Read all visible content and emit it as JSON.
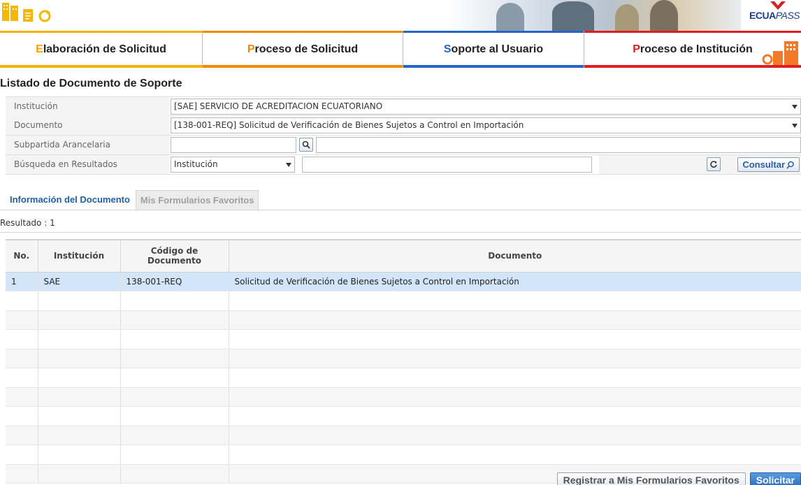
{
  "header": {
    "brand_main": "ECUA",
    "brand_suffix": "PASS",
    "icons": [
      "document-stack-icon",
      "form-icon",
      "refresh-icon"
    ]
  },
  "nav": [
    {
      "first": "E",
      "rest": "laboración de Solicitud"
    },
    {
      "first": "P",
      "rest": "roceso de Solicitud"
    },
    {
      "first": "S",
      "rest": "oporte al Usuario"
    },
    {
      "first": "P",
      "rest": "roceso de Institución"
    }
  ],
  "page_title": "Listado de Documento de Soporte",
  "form": {
    "institucion_label": "Institución",
    "institucion_value": "[SAE] SERVICIO DE ACREDITACION ECUATORIANO",
    "documento_label": "Documento",
    "documento_value": "[138-001-REQ] Solicitud de Verificación de Bienes Sujetos a Control en Importación",
    "subpartida_label": "Subpartida Arancelaria",
    "subpartida_value": "",
    "subpartida_desc": "",
    "busqueda_label": "Búsqueda en Resultados",
    "busqueda_field": "Institución",
    "busqueda_text": "",
    "consultar_label": "Consultar"
  },
  "tabs": {
    "active": "Información del Documento",
    "inactive": "Mis Formularios Favoritos"
  },
  "result_count": "Resultado : 1",
  "table": {
    "headers": [
      "No.",
      "Institución",
      "Código de Documento",
      "Documento"
    ],
    "rows": [
      {
        "no": "1",
        "institucion": "SAE",
        "codigo": "138-001-REQ",
        "documento": "Solicitud de Verificación de Bienes Sujetos a Control en Importación"
      }
    ],
    "empty_rows": 10
  },
  "buttons": {
    "favoritos": "Registrar a Mis Formularios Favoritos",
    "solicitar": "Solicitar"
  },
  "colors": {
    "nav_elaboracion": "#f4a000",
    "nav_proceso": "#f08a00",
    "nav_soporte": "#2565c7",
    "nav_institucion": "#e01e1e",
    "selected_row": "#d3e5f8",
    "tab_active": "#1f5ea8"
  }
}
